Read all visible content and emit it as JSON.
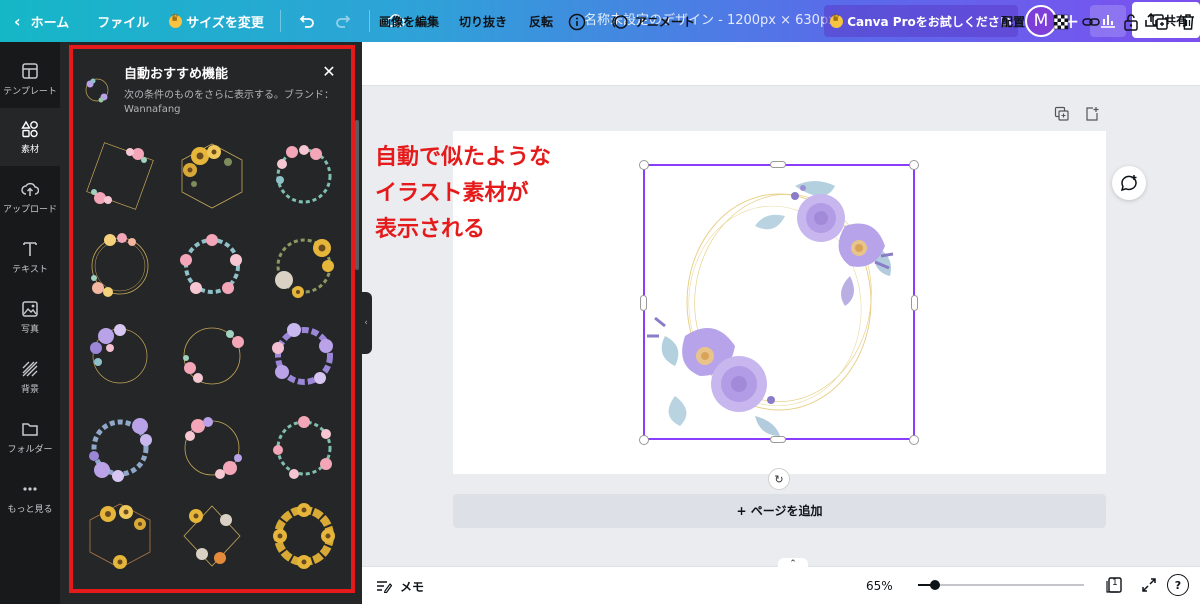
{
  "topbar": {
    "home": "ホーム",
    "file": "ファイル",
    "resize": "サイズを変更",
    "doc_title": "名称未設定のデザイン - 1200px × 630px",
    "pro": "Canva Proをお試しください",
    "avatar_letter": "M",
    "share": "共有"
  },
  "rail": {
    "items": [
      {
        "label": "テンプレート",
        "icon": "template-icon"
      },
      {
        "label": "素材",
        "icon": "elements-icon"
      },
      {
        "label": "アップロード",
        "icon": "upload-icon"
      },
      {
        "label": "テキスト",
        "icon": "text-icon"
      },
      {
        "label": "写真",
        "icon": "photo-icon"
      },
      {
        "label": "背景",
        "icon": "background-icon"
      },
      {
        "label": "フォルダー",
        "icon": "folder-icon"
      },
      {
        "label": "もっと見る",
        "icon": "more-icon"
      }
    ]
  },
  "panel": {
    "title": "自動おすすめ機能",
    "description": "次の条件のものをさらに表示する。ブランド：Wannafang"
  },
  "toolbar": {
    "edit_image": "画像を編集",
    "crop": "切り抜き",
    "flip": "反転",
    "animate": "アニメート",
    "position": "配置"
  },
  "canvas": {
    "add_page": "+ ページを追加"
  },
  "annotation": {
    "lines": [
      "自動で似たような",
      "イラスト素材が",
      "表示される"
    ]
  },
  "bottombar": {
    "memo": "メモ",
    "zoom": "65%",
    "zoom_level": 0.1,
    "page_count": "1",
    "help": "?"
  },
  "colors": {
    "accent": "#8b3dff",
    "annotation": "#e51a1a",
    "panel_bg": "#252627",
    "rail_bg": "#18191b"
  }
}
